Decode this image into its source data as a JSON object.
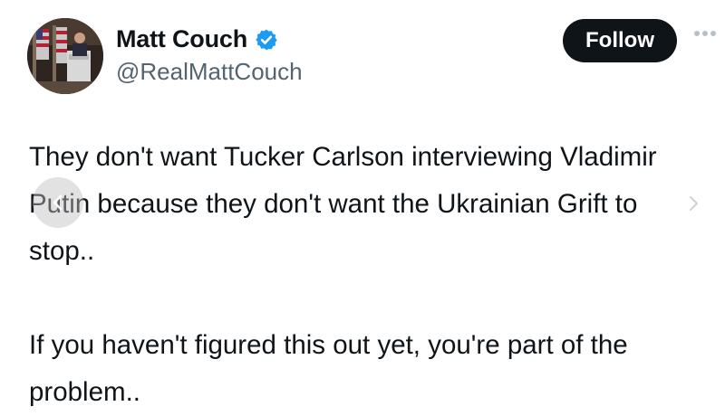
{
  "author": {
    "name": "Matt Couch",
    "handle": "@RealMattCouch",
    "verified": true
  },
  "actions": {
    "follow_label": "Follow",
    "more_icon": "more-dots-icon"
  },
  "tweet": {
    "text": "They don't want Tucker Carlson interviewing Vladimir\nPutin because they don't want the Ukrainian Grift to\nstop..\n\nIf you haven't figured this out yet, you're part of the\nproblem.."
  },
  "colors": {
    "follow_bg": "#0f1419",
    "verified": "#1d9bf0",
    "handle": "#536471"
  }
}
